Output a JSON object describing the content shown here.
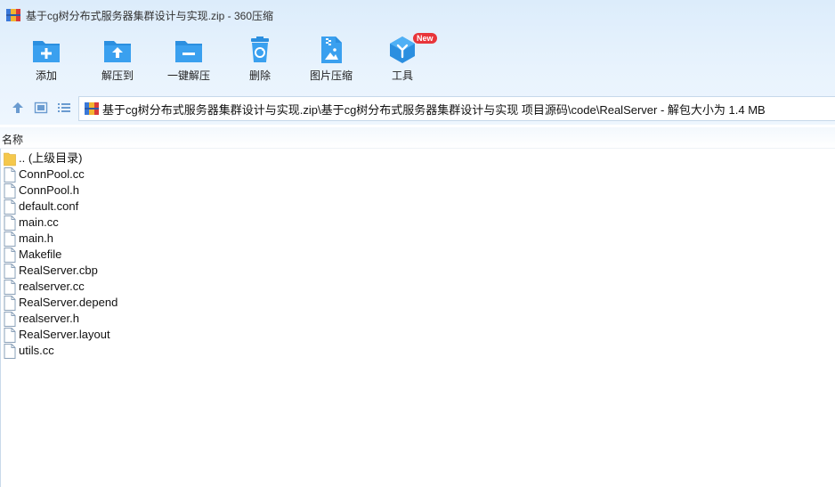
{
  "window": {
    "title": "基于cg树分布式服务器集群设计与实现.zip - 360压缩"
  },
  "toolbar": {
    "add_label": "添加",
    "extract_to_label": "解压到",
    "one_click_extract_label": "一键解压",
    "delete_label": "删除",
    "image_compress_label": "图片压缩",
    "tools_label": "工具",
    "tools_badge": "New"
  },
  "navbar": {
    "path": "基于cg树分布式服务器集群设计与实现.zip\\基于cg树分布式服务器集群设计与实现 项目源码\\code\\RealServer - 解包大小为 1.4 MB"
  },
  "list": {
    "column_name": "名称",
    "parent_dir": ".. (上级目录)",
    "files": [
      "ConnPool.cc",
      "ConnPool.h",
      "default.conf",
      "main.cc",
      "main.h",
      "Makefile",
      "RealServer.cbp",
      "realserver.cc",
      "RealServer.depend",
      "realserver.h",
      "RealServer.layout",
      "utils.cc"
    ]
  },
  "colors": {
    "accent_blue": "#2b8fe0",
    "badge_red": "#e8353a",
    "folder_yellow": "#f5c84c"
  },
  "icons": {
    "title": "archive-icon",
    "add": "add-folder-icon",
    "extract_to": "extract-folder-icon",
    "one_click_extract": "one-click-extract-icon",
    "delete": "recycle-bin-icon",
    "image_compress": "image-zip-icon",
    "tools": "tools-cube-icon",
    "up": "arrow-up-icon",
    "view_thumb": "thumbnail-view-icon",
    "view_list": "list-view-icon",
    "folder": "folder-icon",
    "file": "file-icon"
  }
}
